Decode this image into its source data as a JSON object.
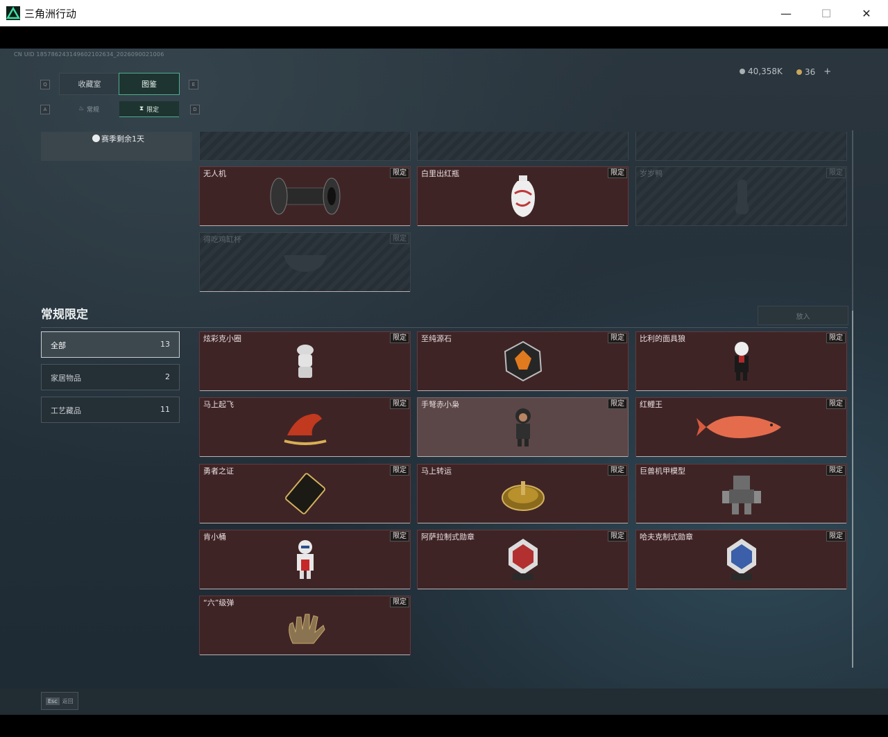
{
  "window": {
    "title": "三角洲行动",
    "min": "—",
    "max": "☐",
    "close": "✕"
  },
  "uid": "CN UID 185786243149602102634_2026090021006",
  "currency": {
    "silver": "40,358K",
    "gold": "36",
    "plus": "+"
  },
  "tabs": {
    "prev_key": "Q",
    "next_key": "E",
    "main": [
      {
        "label": "收藏室"
      },
      {
        "label": "图鉴"
      }
    ],
    "sub_prev_key": "A",
    "sub_next_key": "D",
    "sub": [
      {
        "label": "常规"
      },
      {
        "label": "限定"
      }
    ]
  },
  "season": {
    "text": "赛季剩余1天"
  },
  "top_cards": [
    {
      "name": "无人机",
      "badge": "限定",
      "locked": false,
      "icon": "roller-icon"
    },
    {
      "name": "白里出红瓶",
      "badge": "限定",
      "locked": false,
      "icon": "vase-icon"
    },
    {
      "name": "岁岁鸭",
      "badge": "限定",
      "locked": true,
      "icon": "duck-icon"
    },
    {
      "name": "得吃鸡缸杯",
      "badge": "限定",
      "locked": true,
      "icon": "cup-icon"
    }
  ],
  "section": {
    "title": "常规限定",
    "put_button": "放入"
  },
  "filters": [
    {
      "label": "全部",
      "count": "13",
      "active": true
    },
    {
      "label": "家居物品",
      "count": "2",
      "active": false
    },
    {
      "label": "工艺藏品",
      "count": "11",
      "active": false
    }
  ],
  "items": [
    {
      "name": "炫彩克小圈",
      "badge": "限定",
      "icon": "figurine-white-icon"
    },
    {
      "name": "至纯源石",
      "badge": "限定",
      "icon": "gem-icon"
    },
    {
      "name": "比利的面具狼",
      "badge": "限定",
      "icon": "doll-icon"
    },
    {
      "name": "马上起飞",
      "badge": "限定",
      "icon": "horse-icon"
    },
    {
      "name": "手弩赤小枭",
      "badge": "限定",
      "icon": "hooded-figure-icon"
    },
    {
      "name": "红鲤王",
      "badge": "限定",
      "icon": "fish-icon"
    },
    {
      "name": "勇者之证",
      "badge": "限定",
      "icon": "card-icon"
    },
    {
      "name": "马上转运",
      "badge": "限定",
      "icon": "compass-icon"
    },
    {
      "name": "巨兽机甲模型",
      "badge": "限定",
      "icon": "mech-icon"
    },
    {
      "name": "肯小桶",
      "badge": "限定",
      "icon": "bucket-figure-icon"
    },
    {
      "name": "阿萨拉制式勋章",
      "badge": "限定",
      "icon": "medal-red-icon"
    },
    {
      "name": "哈夫克制式勋章",
      "badge": "限定",
      "icon": "medal-blue-icon"
    },
    {
      "name": "“六”级弹",
      "badge": "限定",
      "icon": "hand-icon"
    }
  ],
  "footer": {
    "key": "Esc",
    "label": "返回"
  }
}
